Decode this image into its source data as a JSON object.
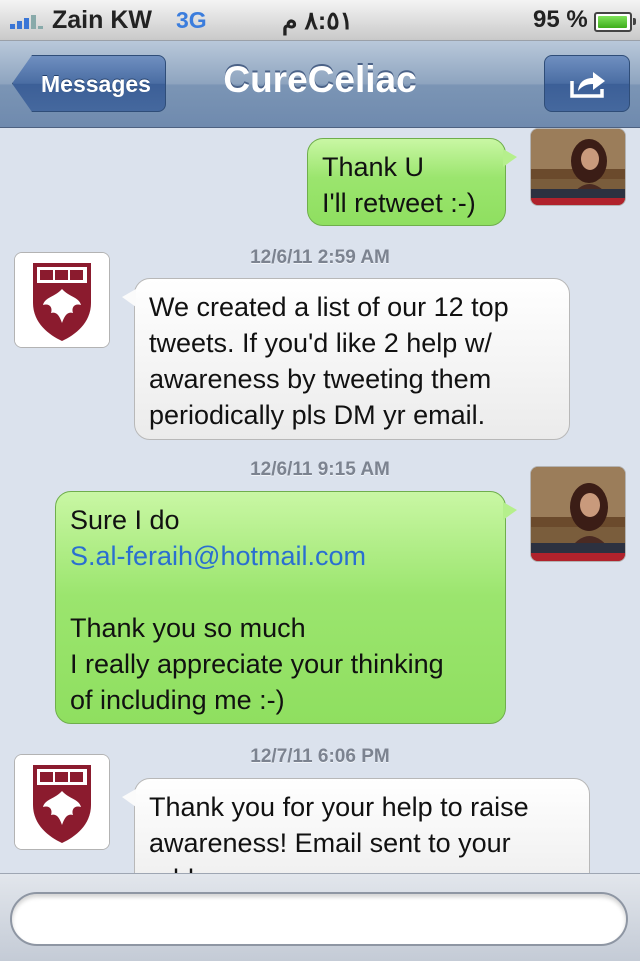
{
  "status_bar": {
    "carrier": "Zain KW",
    "network": "3G",
    "time": "٨:٥١ م",
    "battery_percent": "95 %",
    "battery_level": 0.95,
    "signal_icon": "signal-bars-icon",
    "battery_icon": "battery-icon"
  },
  "nav": {
    "back_label": "Messages",
    "title": "CureCeliac",
    "share_icon": "share-icon"
  },
  "messages": {
    "m1": {
      "direction": "out",
      "lines": [
        "Thank U",
        "I'll retweet :-)"
      ]
    },
    "t2": "12/6/11 2:59 AM",
    "m2": {
      "direction": "in",
      "lines": [
        "We created a list of our 12 top",
        "tweets. If you'd like 2 help w/",
        "awareness by tweeting them",
        "periodically pls DM yr email."
      ]
    },
    "t3": "12/6/11 9:15 AM",
    "m3": {
      "direction": "out",
      "line1": "Sure I do",
      "link": "S.al-feraih@hotmail.com",
      "line3": "Thank you so much",
      "line4": "I really appreciate your thinking",
      "line5": "of including me :-)"
    },
    "t4": "12/7/11 6:06 PM",
    "m4": {
      "direction": "in",
      "lines": [
        "Thank you for your help to raise",
        "awareness! Email sent to your",
        "address."
      ]
    }
  },
  "input": {
    "placeholder": ""
  },
  "colors": {
    "outgoing_bubble": "#9be56e",
    "incoming_bubble": "#f5f5f5",
    "nav_bar": "#8ea4bf",
    "link": "#2a6fd0",
    "contact_logo": "#8b1b2e"
  }
}
